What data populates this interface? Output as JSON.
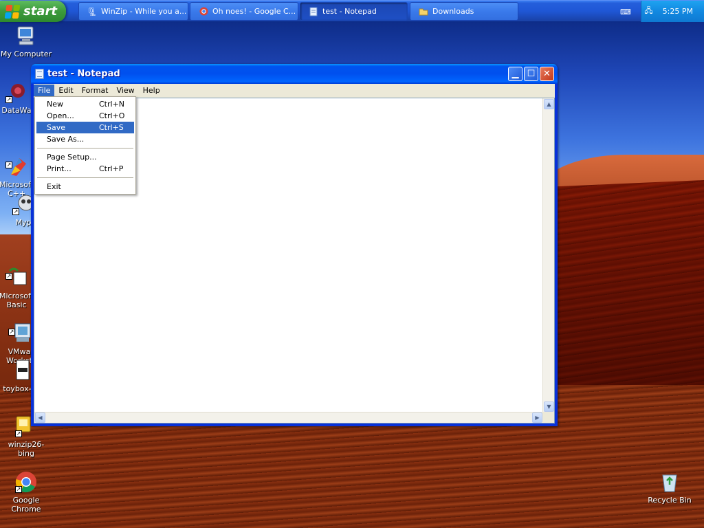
{
  "taskbar": {
    "start_label": "start",
    "tasks": [
      {
        "label": "WinZip - While you a...",
        "icon": "winzip-icon"
      },
      {
        "label": "Oh noes! - Google C...",
        "icon": "chrome-icon"
      },
      {
        "label": "test - Notepad",
        "icon": "notepad-icon"
      },
      {
        "label": "Downloads",
        "icon": "folder-icon"
      }
    ],
    "clock": "5:25 PM"
  },
  "desktop_icons": [
    {
      "label": "My Computer"
    },
    {
      "label": "DataWa"
    },
    {
      "label": "Microsoft\nC++"
    },
    {
      "label": "Myp"
    },
    {
      "label": "Microsoft\nBasic"
    },
    {
      "label": "VMwa\nWorkst"
    },
    {
      "label": "toybox-c"
    },
    {
      "label": "winzip26-bing"
    },
    {
      "label": "Google Chrome"
    },
    {
      "label": "Recycle Bin"
    }
  ],
  "notepad": {
    "title": "test - Notepad",
    "menus": [
      "File",
      "Edit",
      "Format",
      "View",
      "Help"
    ],
    "file_menu": {
      "items": [
        {
          "label": "New",
          "shortcut": "Ctrl+N"
        },
        {
          "label": "Open...",
          "shortcut": "Ctrl+O"
        },
        {
          "label": "Save",
          "shortcut": "Ctrl+S"
        },
        {
          "label": "Save As...",
          "shortcut": ""
        },
        {
          "label": "Page Setup...",
          "shortcut": ""
        },
        {
          "label": "Print...",
          "shortcut": "Ctrl+P"
        },
        {
          "label": "Exit",
          "shortcut": ""
        }
      ],
      "highlighted": "Save"
    }
  },
  "colors": {
    "title_blue": "#0050ee",
    "menu_highlight": "#316ac5",
    "start_green": "#3c9a3c"
  }
}
